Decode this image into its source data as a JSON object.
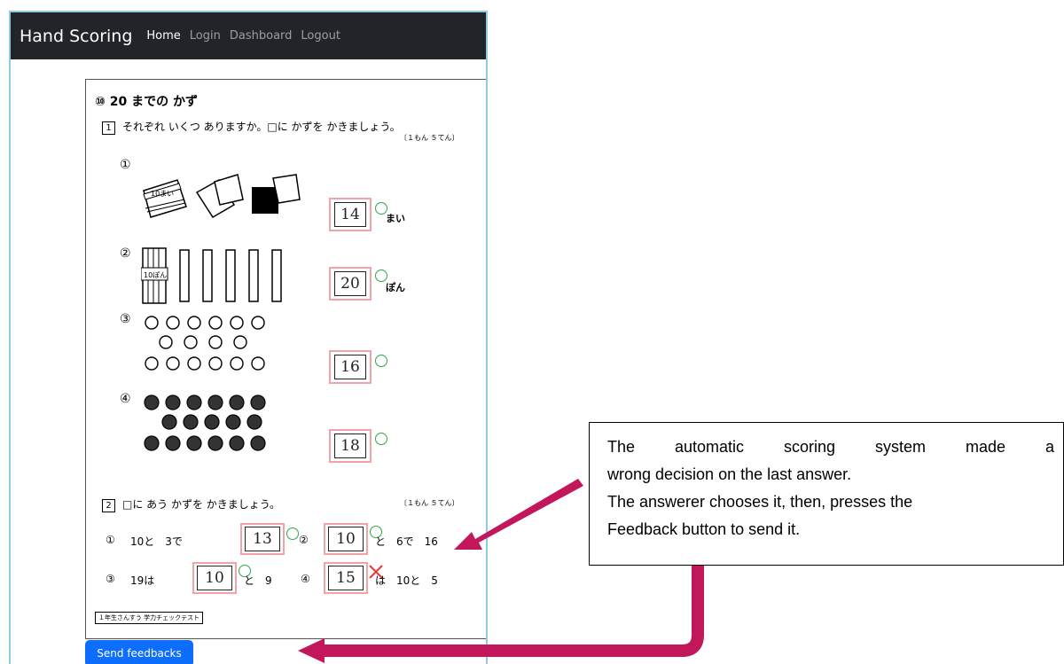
{
  "navbar": {
    "brand": "Hand Scoring",
    "links": [
      "Home",
      "Login",
      "Dashboard",
      "Logout"
    ]
  },
  "worksheet": {
    "title": "⑩ 20 までの かず",
    "q1": {
      "number": "1",
      "instruction": "それぞれ いくつ ありますか。□に かずを かきましょう。",
      "points": "〔１もん ５てん〕",
      "items": [
        {
          "num": "①",
          "answer": "14",
          "unit": "まい"
        },
        {
          "num": "②",
          "answer": "20",
          "unit": "ぽん"
        },
        {
          "num": "③",
          "answer": "16",
          "unit": ""
        },
        {
          "num": "④",
          "answer": "18",
          "unit": ""
        }
      ]
    },
    "q2": {
      "number": "2",
      "instruction": "□に あう かずを かきましょう。",
      "points": "〔１もん ５てん〕",
      "row1": {
        "a_num": "①",
        "a_pre": "10と　3で",
        "a_answer": "13",
        "b_num": "②",
        "b_answer": "10",
        "b_post": "と　6で　16"
      },
      "row2": {
        "a_num": "③",
        "a_pre": "19は",
        "a_answer": "10",
        "a_post": "と　9",
        "b_num": "④",
        "b_answer": "15",
        "b_post": "は　10と　5"
      }
    },
    "footer_label": "１年生さんすう 学力チェックテスト"
  },
  "send_button": "Send feedbacks",
  "callout": {
    "line1": "The automatic scoring system made a",
    "line2": "wrong decision on the last answer.",
    "line3": "The answerer chooses it, then, presses the",
    "line4": "Feedback button to send it."
  },
  "colors": {
    "navbar": "#212529",
    "button": "#0d6efd",
    "arrow": "#c2185b",
    "correct_mark": "#2aa84a",
    "wrong_mark": "#e53935",
    "answer_box": "#f3a3a8"
  }
}
